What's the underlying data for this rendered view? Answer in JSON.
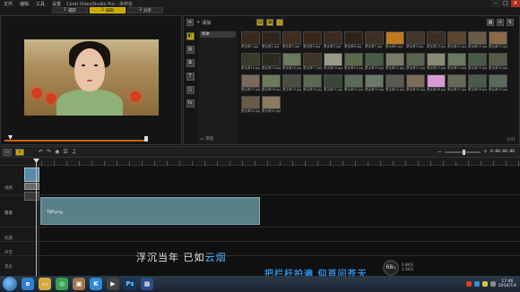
{
  "app": {
    "title": "Corel VideoStudio Pro - 未命名",
    "menu": [
      "文件",
      "编辑",
      "工具",
      "设置"
    ],
    "steps": [
      {
        "num": "1",
        "label": "捕获",
        "active": false
      },
      {
        "num": "2",
        "label": "编辑",
        "active": true
      },
      {
        "num": "3",
        "label": "分享",
        "active": false
      }
    ],
    "window_controls": [
      "–",
      "□",
      "×"
    ]
  },
  "preview": {
    "mode_labels": [
      "项目",
      "素材"
    ],
    "transport_icons": [
      "play-icon",
      "start-icon",
      "prev-frame-icon",
      "next-frame-icon",
      "end-icon",
      "repeat-icon",
      "volume-icon",
      "hd-icon"
    ],
    "timecode": "00:00:00:00"
  },
  "library": {
    "add_label": "添加",
    "folders": [
      "样本"
    ],
    "browse_label": "浏览",
    "thumbnails": [
      {
        "caption": "蒙太奇1.jpg",
        "color": "#3a2a1e"
      },
      {
        "caption": "蒙太奇2.jpg",
        "color": "#2e261e"
      },
      {
        "caption": "蒙太奇3.jpg",
        "color": "#402c1c"
      },
      {
        "caption": "蒙太奇4.jpg",
        "color": "#382818"
      },
      {
        "caption": "蒙太奇5.jpg",
        "color": "#3a2a20"
      },
      {
        "caption": "蒙太奇6.jpg",
        "color": "#2c2418"
      },
      {
        "caption": "蒙太奇7.jpg",
        "color": "#3c2e20"
      },
      {
        "caption": "蒙太奇8.jpg",
        "color": "#c07a1e"
      },
      {
        "caption": "蒙太奇9.jpg",
        "color": "#44362a"
      },
      {
        "caption": "蒙太奇10.jpg",
        "color": "#3a2e22"
      },
      {
        "caption": "蒙太奇11.jpg",
        "color": "#5a4630"
      },
      {
        "caption": "蒙太奇12.jpg",
        "color": "#6a5a48"
      },
      {
        "caption": "蒙太奇13.jpg",
        "color": "#8a6a4a"
      },
      {
        "caption": "蒙太奇14.jpg",
        "color": "#3a3a2a"
      },
      {
        "caption": "蒙太奇15.jpg",
        "color": "#2a2a22"
      },
      {
        "caption": "蒙太奇16.jpg",
        "color": "#6a7a5a"
      },
      {
        "caption": "蒙太奇17.jpg",
        "color": "#3e3428"
      },
      {
        "caption": "蒙太奇18.jpg",
        "color": "#9a9a8a"
      },
      {
        "caption": "蒙太奇19.jpg",
        "color": "#5a6a4a"
      },
      {
        "caption": "蒙太奇20.jpg",
        "color": "#4a5a48"
      },
      {
        "caption": "蒙太奇21.jpg",
        "color": "#7a7a68"
      },
      {
        "caption": "蒙太奇22.jpg",
        "color": "#5a6650"
      },
      {
        "caption": "蒙太奇23.jpg",
        "color": "#8a8a78"
      },
      {
        "caption": "蒙太奇24.jpg",
        "color": "#6a7a60"
      },
      {
        "caption": "蒙太奇25.jpg",
        "color": "#4a5a4a"
      },
      {
        "caption": "蒙太奇26.jpg",
        "color": "#5a5a4a"
      },
      {
        "caption": "蒙太奇27.jpg",
        "color": "#7a6a5a"
      },
      {
        "caption": "蒙太奇28.jpg",
        "color": "#6a7a5a"
      },
      {
        "caption": "蒙太奇29.jpg",
        "color": "#4a5040"
      },
      {
        "caption": "蒙太奇30.jpg",
        "color": "#5a6a50"
      },
      {
        "caption": "蒙太奇31.jpg",
        "color": "#3a4638"
      },
      {
        "caption": "蒙太奇32.jpg",
        "color": "#5a6a58"
      },
      {
        "caption": "蒙太奇33.jpg",
        "color": "#6a7a6a"
      },
      {
        "caption": "蒙太奇34.jpg",
        "color": "#5a5a50"
      },
      {
        "caption": "蒙太奇35.jpg",
        "color": "#7a6e5a"
      },
      {
        "caption": "蒙太奇36.jpg",
        "color": "#d79ad2"
      },
      {
        "caption": "蒙太奇37.jpg",
        "color": "#6a6a58"
      },
      {
        "caption": "蒙太奇38.jpg",
        "color": "#4a5a48"
      },
      {
        "caption": "蒙太奇39.jpg",
        "color": "#5a6a5a"
      },
      {
        "caption": "蒙太奇40.jpg",
        "color": "#6a5a48"
      },
      {
        "caption": "蒙太奇41.jpg",
        "color": "#8a7a60"
      }
    ],
    "status": "1/41"
  },
  "timeline": {
    "time": "0:00:00:00",
    "track_labels": [
      "视频",
      "覆叠",
      "标题",
      "声音",
      "音乐"
    ],
    "overlay_clip_name": "TBP.png"
  },
  "subtitles": {
    "line1_a": "浮沉当年  已如",
    "line1_b": "云烟",
    "line2": "把栏杆拍遍  仰首问苍天"
  },
  "system": {
    "gauge_value": "68",
    "gauge_unit": "%",
    "gauge_info": [
      "0.8K/S",
      "3.5K/S"
    ],
    "clock_time": "17:46",
    "clock_date": "2016/7/4",
    "colors": {
      "accent": "#c8a800",
      "overlay_clip": "#5b7f89",
      "scrub": "#c86400"
    }
  }
}
